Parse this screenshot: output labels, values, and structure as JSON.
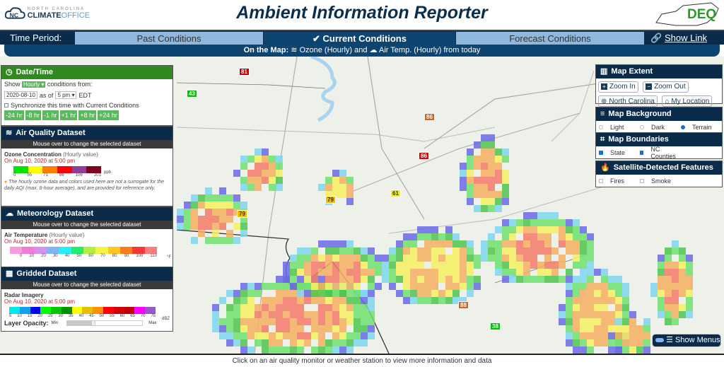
{
  "header": {
    "logo_left": {
      "line1": "NORTH CAROLINA",
      "line2_bold": "CLIMATE",
      "line2_light": "OFFICE"
    },
    "title": "Ambient Information Reporter",
    "logo_right": "DEQ"
  },
  "time_period": {
    "label": "Time Period:",
    "tabs": [
      {
        "label": "Past Conditions",
        "active": false
      },
      {
        "label": "Current Conditions",
        "active": true
      },
      {
        "label": "Forecast Conditions",
        "active": false
      }
    ],
    "show_link": "Show Link"
  },
  "on_map": {
    "prefix": "On the Map:",
    "item1": "Ozone (Hourly) and",
    "item2": "Air Temp. (Hourly) from today"
  },
  "datetime": {
    "title": "Date/Time",
    "show_label": "Show",
    "interval": "Hourly",
    "conditions_from": "conditions from:",
    "date": "2020-08-10",
    "as_of": "as of",
    "hour": "5 pm",
    "tz": "EDT",
    "sync_label": "Synchronize this time with Current Conditions",
    "step_buttons": [
      "-24 hr",
      "-8 hr",
      "-1 hr",
      "+1 hr",
      "+8 hr",
      "+24 hr"
    ]
  },
  "air_quality": {
    "title": "Air Quality Dataset",
    "subheader": "Mouse over to change the selected dataset",
    "dataset": "Ozone Concentration",
    "dataset_note": "(Hourly value)",
    "timestamp": "On Aug 10, 2020 at 5:00 pm",
    "legend_colors": [
      "#00e400",
      "#ffff00",
      "#ff7e00",
      "#ff0000",
      "#8f3f97",
      "#7e0023"
    ],
    "legend_ticks": [
      "0",
      "55",
      "71",
      "86",
      "106",
      "201"
    ],
    "unit": "ppb",
    "notice": "The hourly ozone data and colors used here are not a surrogate for the daily AQI (max. 8-hour average), and are provided for reference only."
  },
  "meteorology": {
    "title": "Meteorology Dataset",
    "subheader": "Mouse over to change the selected dataset",
    "dataset": "Air Temperature",
    "dataset_note": "(Hourly value)",
    "timestamp": "On Aug 10, 2020 at 5:00 pm",
    "legend_colors": [
      "#f79be0",
      "#f37ad8",
      "#d98ff2",
      "#7fb5f5",
      "#22f0f5",
      "#1ef067",
      "#b1ef45",
      "#f5f540",
      "#ffc81e",
      "#ff7a1e",
      "#ff3535",
      "#ff7c7c"
    ],
    "legend_ticks": [
      "0",
      "10",
      "20",
      "30",
      "40",
      "50",
      "60",
      "70",
      "80",
      "90",
      "100",
      "110"
    ],
    "unit": "°F"
  },
  "gridded": {
    "title": "Gridded Dataset",
    "subheader": "Mouse over to change the selected dataset",
    "dataset": "Radar Imagery",
    "timestamp": "On Aug 10, 2020 at 5:00 pm",
    "legend_colors": [
      "#00e8e8",
      "#10a0f0",
      "#0000f0",
      "#00ff00",
      "#00c800",
      "#009000",
      "#ffff00",
      "#e6c000",
      "#ff9000",
      "#ff0000",
      "#d00000",
      "#c00000",
      "#ff00ff",
      "#9955c9"
    ],
    "legend_ticks": [
      "5",
      "10",
      "15",
      "20",
      "25",
      "30",
      "35",
      "40",
      "45",
      "50",
      "55",
      "60",
      "65",
      "70",
      "75"
    ],
    "unit": "dBZ",
    "opacity_label": "Layer Opacity:",
    "opacity_min": "Min",
    "opacity_max": "Max",
    "opacity_value": 0.35
  },
  "map_extent": {
    "title": "Map Extent",
    "buttons": [
      "Zoom In",
      "Zoom Out",
      "North Carolina",
      "My Location"
    ]
  },
  "map_background": {
    "title": "Map Background",
    "options": [
      "Light",
      "Dark",
      "Terrain"
    ],
    "selected": "Terrain"
  },
  "map_boundaries": {
    "title": "Map Boundaries",
    "options": [
      {
        "label": "State",
        "checked": true
      },
      {
        "label": "NC Counties",
        "checked": true
      }
    ]
  },
  "satellite": {
    "title": "Satellite-Detected Features",
    "options": [
      {
        "label": "Fires",
        "checked": false
      },
      {
        "label": "Smoke",
        "checked": false
      }
    ]
  },
  "markers": [
    {
      "value": "81",
      "color": "#cc0000"
    },
    {
      "value": "43",
      "color": "#00c000"
    },
    {
      "value": "86",
      "color": "#e06010"
    },
    {
      "value": "86",
      "color": "#e00000"
    },
    {
      "value": "61",
      "color": "#f5f000"
    },
    {
      "value": "79",
      "color": "#f0c000"
    },
    {
      "value": "79",
      "color": "#f0c000"
    },
    {
      "value": "88",
      "color": "#e06010"
    },
    {
      "value": "38",
      "color": "#00c000"
    }
  ],
  "show_menus": "Show Menus",
  "footer": "Click on an air quality monitor or weather station to view more information and data"
}
